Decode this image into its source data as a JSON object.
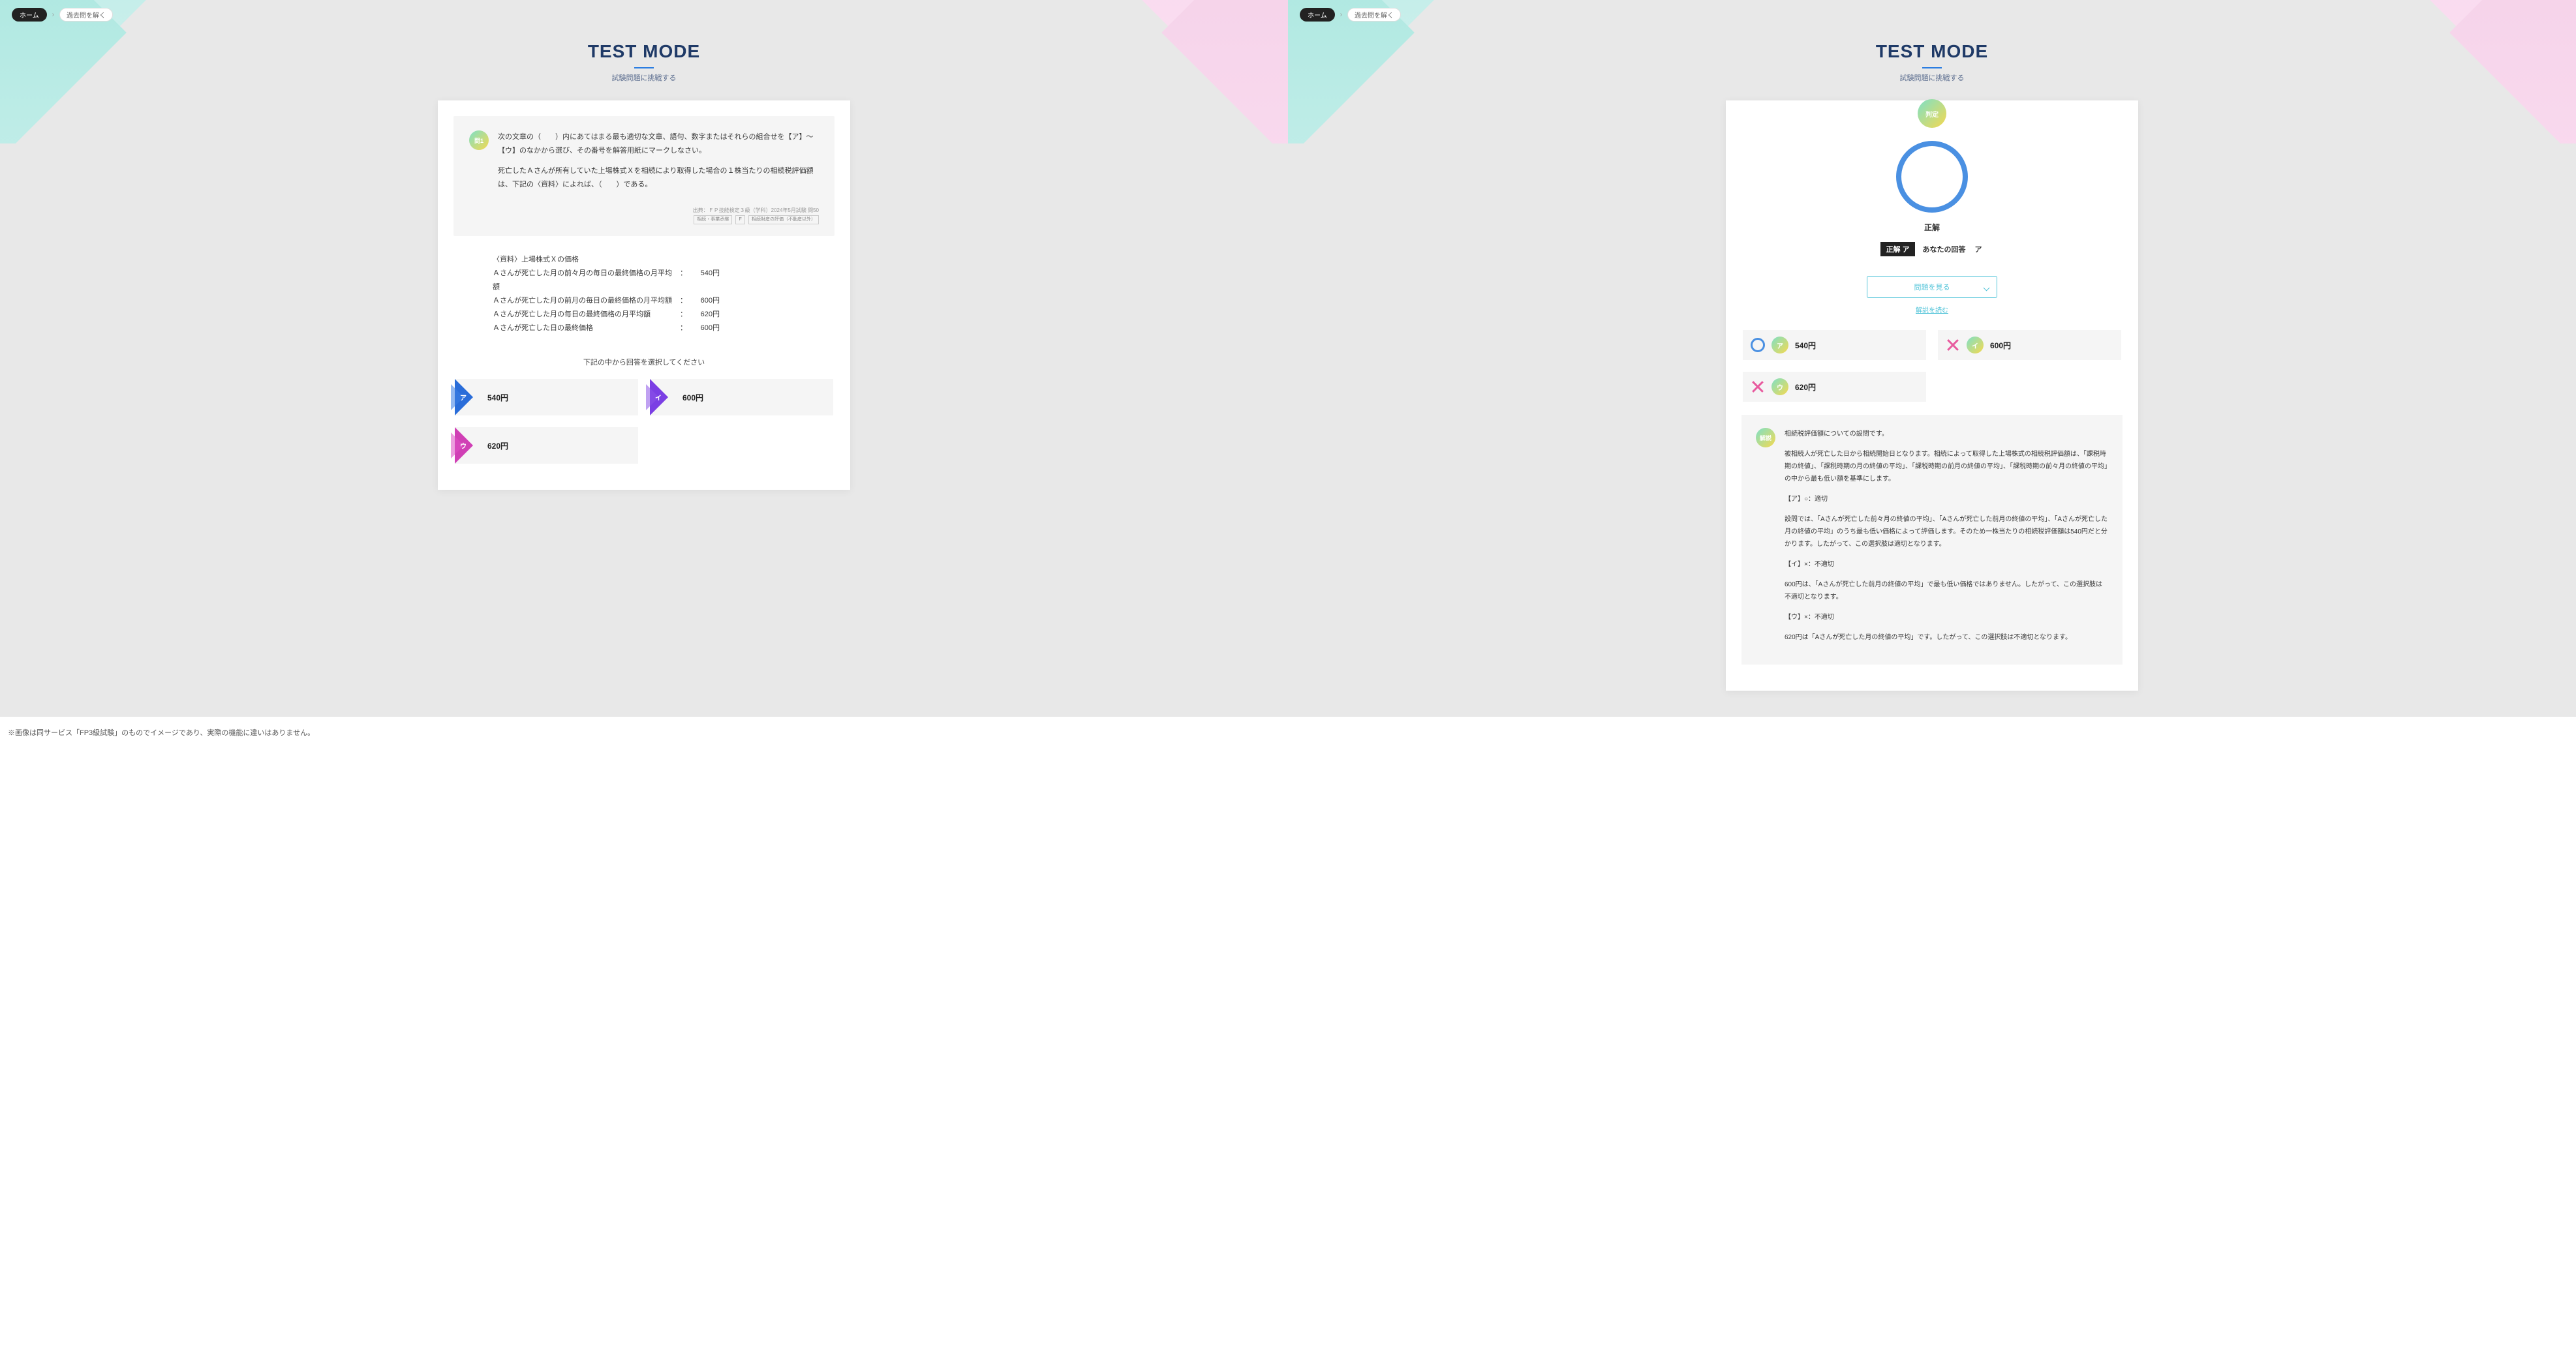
{
  "breadcrumbs": {
    "home": "ホーム",
    "item": "過去問を解く"
  },
  "hero": {
    "title": "TEST MODE",
    "sub": "試験問題に挑戦する"
  },
  "question": {
    "badge": "問1",
    "p1": "次の文章の（　　）内にあてはまる最も適切な文章、語句、数字またはそれらの組合せを【ア】〜【ウ】のなかから選び、その番号を解答用紙にマークしなさい。",
    "p2": "死亡したＡさんが所有していた上場株式Ｘを相続により取得した場合の１株当たりの相続税評価額は、下記の〈資料〉によれば、（　　）である。",
    "meta_line1": "出典：ＦＰ技能検定３級（学科）2024年5月試験 問50",
    "meta_tag1": "相続・事業承継",
    "meta_tag2": "F",
    "meta_tag3": "相続財産の評価（不動産以外）"
  },
  "material": {
    "title": "〈資料〉上場株式Ｘの価格",
    "rows": [
      {
        "label": "Ａさんが死亡した月の前々月の毎日の最終価格の月平均額",
        "sep": "：",
        "val": "540円"
      },
      {
        "label": "Ａさんが死亡した月の前月の毎日の最終価格の月平均額",
        "sep": "：",
        "val": "600円"
      },
      {
        "label": "Ａさんが死亡した月の毎日の最終価格の月平均額",
        "sep": "：",
        "val": "620円"
      },
      {
        "label": "Ａさんが死亡した日の最終価格",
        "sep": "：",
        "val": "600円"
      }
    ]
  },
  "instruction": "下記の中から回答を選択してください",
  "choices": [
    {
      "letter": "ア",
      "text": "540円"
    },
    {
      "letter": "イ",
      "text": "600円"
    },
    {
      "letter": "ウ",
      "text": "620円"
    }
  ],
  "result": {
    "judge": "判定",
    "label": "正解",
    "correct_prefix": "正解",
    "correct_letter": "ア",
    "your_label": "あなたの回答",
    "your_letter": "ア",
    "view_question": "問題を見る",
    "read_explanation": "解説を読む"
  },
  "res_choices": [
    {
      "letter": "ア",
      "text": "540円",
      "correct": true
    },
    {
      "letter": "イ",
      "text": "600円",
      "correct": false
    },
    {
      "letter": "ウ",
      "text": "620円",
      "correct": false
    }
  ],
  "explanation": {
    "badge": "解説",
    "p1": "相続税評価額についての設問です。",
    "p2": "被相続人が死亡した日から相続開始日となります。相続によって取得した上場株式の相続税評価額は、「課税時期の終値」、「課税時期の月の終値の平均」、「課税時期の前月の終値の平均」、「課税時期の前々月の終値の平均」の中から最も低い額を基準にします。",
    "p3": "【ア】○：適切",
    "p4": "設問では、「Aさんが死亡した前々月の終値の平均」、「Aさんが死亡した前月の終値の平均」、「Aさんが死亡した月の終値の平均」のうち最も低い価格によって評価します。そのため一株当たりの相続税評価額は540円だと分かります。したがって、この選択肢は適切となります。",
    "p5": "【イ】×：不適切",
    "p6": "600円は、「Aさんが死亡した前月の終値の平均」で最も低い価格ではありません。したがって、この選択肢は不適切となります。",
    "p7": "【ウ】×：不適切",
    "p8": "620円は「Aさんが死亡した月の終値の平均」です。したがって、この選択肢は不適切となります。"
  },
  "note": "※画像は同サービス「FP3級試験」のものでイメージであり、実際の機能に違いはありません。"
}
